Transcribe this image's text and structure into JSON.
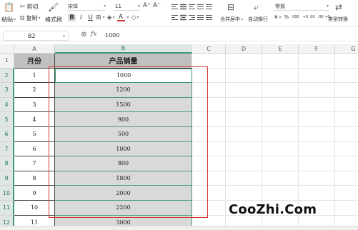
{
  "ribbon": {
    "paste_label": "粘贴",
    "cut_label": "剪切",
    "copy_label": "复制",
    "format_painter_label": "格式刷",
    "font_name": "宋体",
    "font_size": "11",
    "bold": "B",
    "italic": "I",
    "underline": "U",
    "font_color_label": "A",
    "grow_font": "A⁺",
    "shrink_font": "A⁻",
    "merge_center_label": "合并居中",
    "wrap_text_label": "自动换行",
    "number_format": "常规",
    "currency_symbol": "¥",
    "percent_symbol": "%",
    "thousands_symbol": "000",
    "inc_decimal": "+0 .00",
    "dec_decimal": ".00 +0",
    "type_convert_label": "类型转换"
  },
  "formula_bar": {
    "name_box": "B2",
    "fx": "fx",
    "value": "1000"
  },
  "columns": [
    "A",
    "B",
    "C",
    "D",
    "E",
    "F",
    "G"
  ],
  "rows": [
    "1",
    "2",
    "3",
    "4",
    "5",
    "6",
    "7",
    "8",
    "9",
    "10",
    "11",
    "12"
  ],
  "table": {
    "header_month": "月份",
    "header_sales": "产品销量",
    "months": [
      "1",
      "2",
      "3",
      "4",
      "5",
      "6",
      "7",
      "8",
      "9",
      "10",
      "11"
    ],
    "sales": [
      "1000",
      "1200",
      "1500",
      "900",
      "500",
      "1000",
      "800",
      "1800",
      "2000",
      "2200",
      "3000"
    ]
  },
  "watermark": "CooZhi.Com",
  "colors": {
    "selection_outline": "#d23a34",
    "active_green": "#3a9c70",
    "header_fill": "#c0c0c0",
    "selected_fill": "#d9d9d9"
  }
}
